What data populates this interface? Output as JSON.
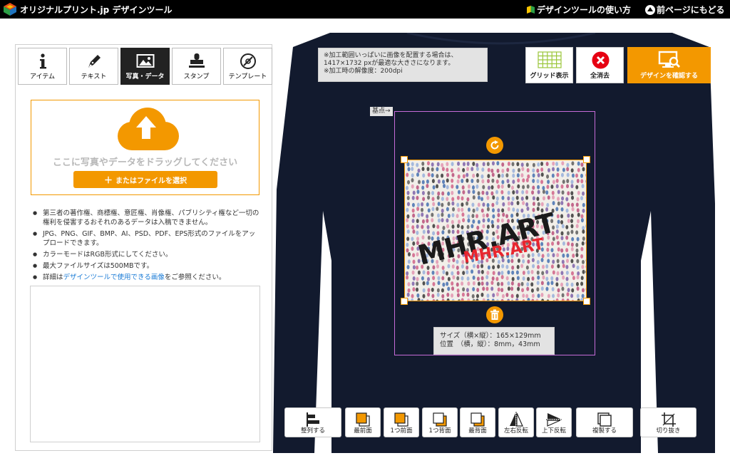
{
  "header": {
    "brand": "オリジナルプリント.jp デザインツール",
    "help_link": "デザインツールの使い方",
    "back_link": "前ページにもどる"
  },
  "tabs": [
    {
      "label": "アイテム",
      "icon": "info-icon"
    },
    {
      "label": "テキスト",
      "icon": "pen-icon"
    },
    {
      "label": "写真・データ",
      "icon": "image-icon"
    },
    {
      "label": "スタンプ",
      "icon": "stamp-icon"
    },
    {
      "label": "テンプレート",
      "icon": "template-icon"
    }
  ],
  "upload": {
    "drop_text": "ここに写真やデータをドラッグしてください",
    "file_button": "またはファイルを選択"
  },
  "notes": {
    "n1": "第三者の著作権、商標権、意匠権、肖像権、パブリシティ権など一切の権利を侵害するおそれのあるデータは入稿できません。",
    "n2": "JPG、PNG、GIF、BMP、AI、PSD、PDF、EPS形式のファイルをアップロードできます。",
    "n3": "カラーモードはRGB形式にしてください。",
    "n4": "最大ファイルサイズは500MBです。",
    "n5_pre": "詳細は",
    "n5_link": "デザインツールで使用できる画像",
    "n5_post": "をご参照ください。"
  },
  "canvas": {
    "info_line1": "※加工範囲いっぱいに画像を配置する場合は、",
    "info_line2": "1417×1732 pxが最適な大きさになります。",
    "info_line3": "※加工時の解像度：200dpi",
    "kiten": "基点→",
    "grid_button": "グリッド表示",
    "clear_button": "全消去",
    "confirm_button": "デザインを確認する",
    "design_text": "MHR.ART",
    "design_text_small": "MHR.ART",
    "size_line": "サイズ（横×縦）：165×129mm",
    "position_line": "位置　（横，縦）：8mm，43mm",
    "shirt_color": "#121a2e",
    "accent_color": "#f39800"
  },
  "toolbar": [
    {
      "label": "整列する",
      "icon": "align-icon"
    },
    {
      "label": "最前面",
      "icon": "bring-front-icon"
    },
    {
      "label": "1つ前面",
      "icon": "forward-icon"
    },
    {
      "label": "1つ背面",
      "icon": "backward-icon"
    },
    {
      "label": "最背面",
      "icon": "send-back-icon"
    },
    {
      "label": "左右反転",
      "icon": "flip-horizontal-icon"
    },
    {
      "label": "上下反転",
      "icon": "flip-vertical-icon"
    },
    {
      "label": "複製する",
      "icon": "duplicate-icon"
    },
    {
      "label": "切り抜き",
      "icon": "crop-icon"
    }
  ]
}
